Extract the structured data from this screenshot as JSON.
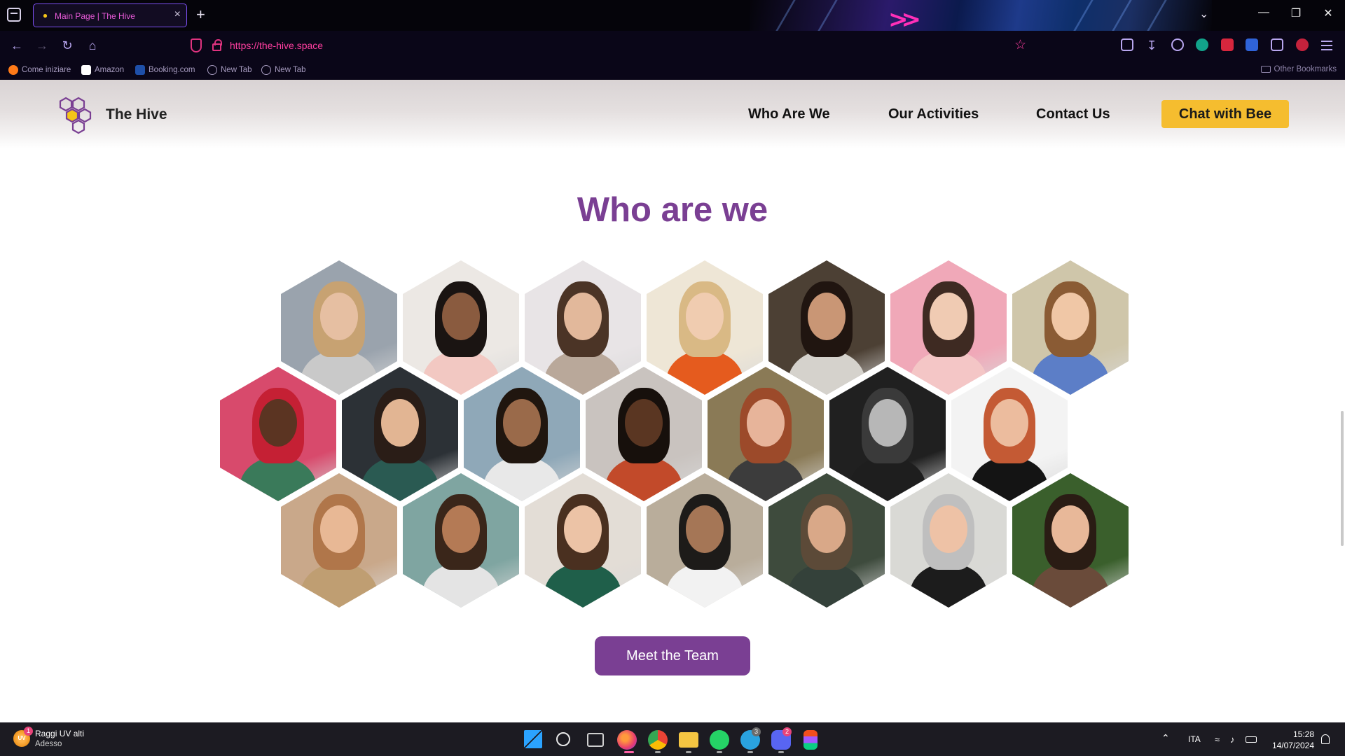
{
  "browser": {
    "tab_title": "Main Page | The Hive",
    "url": "https://the-hive.space",
    "bookmarks": [
      "Come iniziare",
      "Amazon",
      "Booking.com",
      "New Tab",
      "New Tab"
    ],
    "other_bookmarks": "Other Bookmarks"
  },
  "site": {
    "logo_text": "The Hive",
    "menu": [
      "Who Are We",
      "Our Activities",
      "Contact Us"
    ],
    "cta_label": "Chat with Bee",
    "section_title": "Who are we",
    "team_button": "Meet the Team",
    "colors": {
      "brand_purple": "#7a3f93",
      "cta_yellow": "#f5bd2f"
    },
    "team_photos": [
      {
        "bg": "#9aa3ad",
        "skin": "#e6bfa2",
        "hair": "#c7a272",
        "top": "#c9c9c9"
      },
      {
        "bg": "#ece8e4",
        "skin": "#8a5b3f",
        "hair": "#1a1412",
        "top": "#f2c8c2"
      },
      {
        "bg": "#e8e4e6",
        "skin": "#e2b89b",
        "hair": "#4b3426",
        "top": "#b9a89a"
      },
      {
        "bg": "#eee6d6",
        "skin": "#f0ccb0",
        "hair": "#d9b985",
        "top": "#e55b1e"
      },
      {
        "bg": "#4c4034",
        "skin": "#c99675",
        "hair": "#201510",
        "top": "#d5d2cc"
      },
      {
        "bg": "#f0a8b8",
        "skin": "#f0cbb3",
        "hair": "#3e2a22",
        "top": "#f4c6c6"
      },
      {
        "bg": "#cfc6aa",
        "skin": "#f0c7a6",
        "hair": "#8a5b34",
        "top": "#5c7ec7"
      },
      {
        "bg": "#d84a6c",
        "skin": "#5b3422",
        "hair": "#c52034",
        "top": "#3a7a5a"
      },
      {
        "bg": "#2c3136",
        "skin": "#e2b593",
        "hair": "#2a1d17",
        "top": "#2a5a52"
      },
      {
        "bg": "#8fa8b8",
        "skin": "#9a6a4a",
        "hair": "#20160f",
        "top": "#e8e8e8"
      },
      {
        "bg": "#c9c3bf",
        "skin": "#5a3622",
        "hair": "#17100c",
        "top": "#c24a2a"
      },
      {
        "bg": "#8a7a56",
        "skin": "#e7b49a",
        "hair": "#9c4a2a",
        "top": "#3c3c3c"
      },
      {
        "bg": "#202020",
        "skin": "#b7b7b7",
        "hair": "#3a3a3a",
        "top": "#1e1e1e"
      },
      {
        "bg": "#f3f3f3",
        "skin": "#ecbc9e",
        "hair": "#c45a34",
        "top": "#141414"
      },
      {
        "bg": "#c9a88a",
        "skin": "#e8b895",
        "hair": "#b0764a",
        "top": "#bf9e72"
      },
      {
        "bg": "#7fa5a1",
        "skin": "#b47a55",
        "hair": "#3a261a",
        "top": "#e4e4e4"
      },
      {
        "bg": "#e3ddd6",
        "skin": "#ecc3a6",
        "hair": "#4a3020",
        "top": "#1f5f4a"
      },
      {
        "bg": "#b9ad9b",
        "skin": "#a57656",
        "hair": "#1d1b19",
        "top": "#f2f2f2"
      },
      {
        "bg": "#3e4b3d",
        "skin": "#d9a888",
        "hair": "#5c4a38",
        "top": "#34413a"
      },
      {
        "bg": "#d9d9d5",
        "skin": "#eec2a6",
        "hair": "#bfbfbf",
        "top": "#1c1c1c"
      },
      {
        "bg": "#3a5f2c",
        "skin": "#e8b899",
        "hair": "#2a1c14",
        "top": "#6a4b3a"
      }
    ]
  },
  "taskbar": {
    "weather_title": "Raggi UV alti",
    "weather_sub": "Adesso",
    "weather_badge": "1",
    "weather_icon_text": "UV",
    "language": "ITA",
    "time": "15:28",
    "date": "14/07/2024",
    "badges": {
      "telegram": "3",
      "discord": "2"
    }
  }
}
